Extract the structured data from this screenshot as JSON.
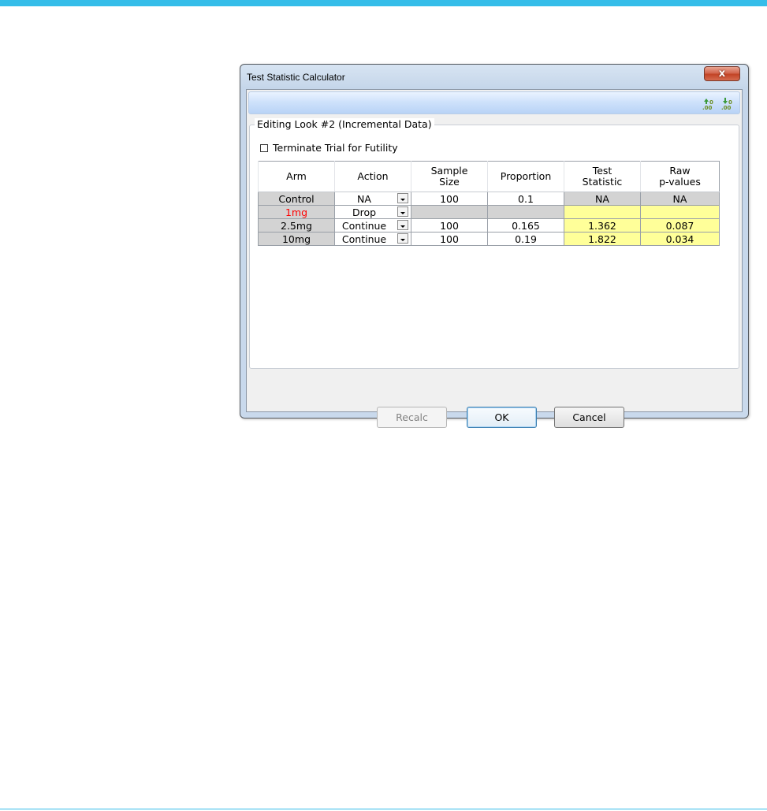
{
  "window": {
    "title": "Test Statistic Calculator",
    "close_label": "x"
  },
  "toolbar": {
    "icons": [
      "increase-decimal-icon",
      "decrease-decimal-icon"
    ]
  },
  "group": {
    "legend": "Editing Look #2 (Incremental Data)",
    "futility_label": "Terminate Trial for Futility",
    "futility_checked": false
  },
  "table": {
    "headers": [
      [
        "Arm"
      ],
      [
        "Action"
      ],
      [
        "Sample",
        "Size"
      ],
      [
        "Proportion"
      ],
      [
        "Test",
        "Statistic"
      ],
      [
        "Raw",
        "p-values"
      ]
    ],
    "rows": [
      {
        "arm": "Control",
        "action": "NA",
        "sample_size": "100",
        "proportion": "0.1",
        "test_statistic": "NA",
        "p_value": "NA"
      },
      {
        "arm": "1mg",
        "action": "Drop",
        "sample_size": "",
        "proportion": "",
        "test_statistic": "",
        "p_value": ""
      },
      {
        "arm": "2.5mg",
        "action": "Continue",
        "sample_size": "100",
        "proportion": "0.165",
        "test_statistic": "1.362",
        "p_value": "0.087"
      },
      {
        "arm": "10mg",
        "action": "Continue",
        "sample_size": "100",
        "proportion": "0.19",
        "test_statistic": "1.822",
        "p_value": "0.034"
      }
    ]
  },
  "buttons": {
    "recalc": "Recalc",
    "ok": "OK",
    "cancel": "Cancel"
  },
  "colors": {
    "accent_bar": "#35bde9",
    "computed_cell": "#ffff99",
    "readonly_cell": "#d3d3d3",
    "dropped_arm": "#ff0000"
  }
}
